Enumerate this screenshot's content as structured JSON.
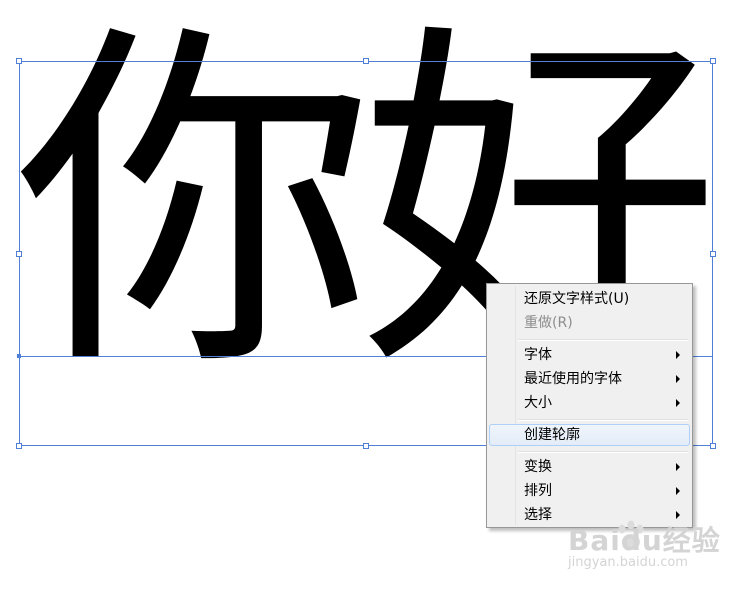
{
  "canvas": {
    "text_object": {
      "glyphs": [
        "你",
        "好"
      ],
      "fill_color": "#000000",
      "selection_color": "#4f7fd6"
    }
  },
  "context_menu": {
    "items": [
      {
        "label": "还原文字样式(U)",
        "enabled": true,
        "submenu": false
      },
      {
        "label": "重做(R)",
        "enabled": false,
        "submenu": false
      },
      {
        "label": "字体",
        "enabled": true,
        "submenu": true
      },
      {
        "label": "最近使用的字体",
        "enabled": true,
        "submenu": true
      },
      {
        "label": "大小",
        "enabled": true,
        "submenu": true
      },
      {
        "label": "创建轮廓",
        "enabled": true,
        "submenu": false,
        "highlighted": true
      },
      {
        "label": "变换",
        "enabled": true,
        "submenu": true
      },
      {
        "label": "排列",
        "enabled": true,
        "submenu": true
      },
      {
        "label": "选择",
        "enabled": true,
        "submenu": true
      }
    ]
  },
  "watermark": {
    "brand": "Baidu经验",
    "url": "jingyan.baidu.com",
    "icon": "paw-logo"
  }
}
